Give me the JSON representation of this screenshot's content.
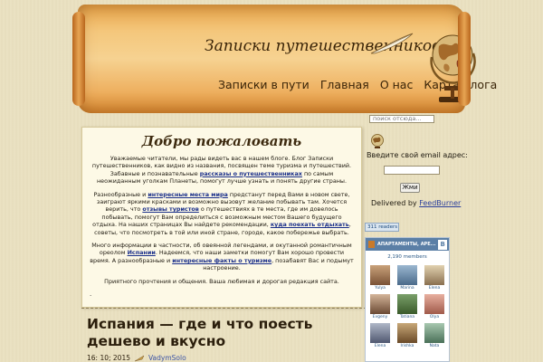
{
  "header": {
    "site_title": "Записки путешественников",
    "nav": [
      "Записки в пути",
      "Главная",
      "О нас",
      "Карта блога"
    ]
  },
  "main": {
    "welcome": "Добро пожаловать",
    "p1_a": "Уважаемые читатели, мы рады видеть вас в нашем блоге. Блог Записки путешественников, как видно из названия, посвящен теме туризма и путешествий. Забавные и познавательные ",
    "p1_link": "рассказы о путешественниках",
    "p1_b": " по самым неожиданным уголкам Планеты, помогут лучше узнать и понять другие страны.",
    "p2_a": "Разнообразные и ",
    "p2_link1": "интересные места мира",
    "p2_b": " предстанут перед Вами в новом свете, заиграют яркими красками и возможно вызовут желание побывать там. Хочется верить, что ",
    "p2_link2": "отзывы туристов",
    "p2_c": " о путешествиях в те места, где им довелось побывать, помогут Вам определиться с возможным местом Вашего будущего отдыха. На наших страницах Вы найдете рекомендации, ",
    "p2_link3": "куда поехать отдыхать",
    "p2_d": ", советы, что посмотреть в той или иной стране, городе, какое побережье выбрать.",
    "p3_a": "Много информации в частности, об овеянной легендами, и окутанной романтичным ореолом ",
    "p3_link1": "Испании",
    "p3_b": ". Надеемся, что наши заметки помогут Вам хорошо провести время. А разнообразные и ",
    "p3_link2": "интересные факты о туризме",
    "p3_c": ", позабавят Вас и подымут настроение.",
    "p4": "Приятного прочтения и общения. Ваша любимая и дорогая редакция сайта.",
    "dot": "."
  },
  "post": {
    "title": "Испания — где и что поесть дешево и вкусно",
    "datetime": "16: 10; 2015",
    "author": "VadymSolo"
  },
  "sidebar": {
    "search_placeholder": "поиск отсюда...",
    "email_label": "Введите свой email адрес:",
    "subscribe_label": "Жми",
    "delivered_prefix": "Delivered by ",
    "delivered_link": "FeedBurner",
    "readers_badge": "311 readers",
    "vk": {
      "group_name": "АПАРТАМЕНТЫ, АРЕ...",
      "logo": "В",
      "members_count": "2,190 members",
      "members": [
        "Yulya",
        "Marina",
        "Elena",
        "Evgeny",
        "Tatiana",
        "Olya",
        "Elena",
        "Irishka",
        "Nata"
      ]
    }
  },
  "colors": {
    "page_bg": "#ebe3c5",
    "scroll": "#f4c77c",
    "link": "#1a2f8a",
    "vk_blue": "#5b7fa6"
  }
}
